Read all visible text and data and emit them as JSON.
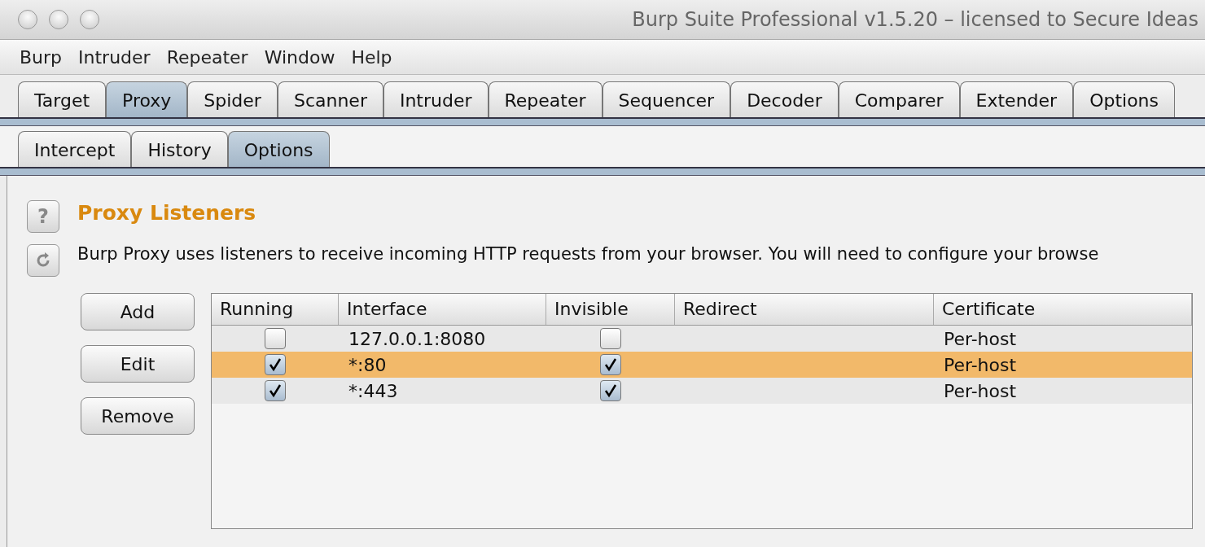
{
  "window": {
    "title": "Burp Suite Professional v1.5.20 – licensed to Secure Ideas"
  },
  "menu": [
    "Burp",
    "Intruder",
    "Repeater",
    "Window",
    "Help"
  ],
  "tabs": [
    {
      "label": "Target",
      "selected": false
    },
    {
      "label": "Proxy",
      "selected": true
    },
    {
      "label": "Spider",
      "selected": false
    },
    {
      "label": "Scanner",
      "selected": false
    },
    {
      "label": "Intruder",
      "selected": false
    },
    {
      "label": "Repeater",
      "selected": false
    },
    {
      "label": "Sequencer",
      "selected": false
    },
    {
      "label": "Decoder",
      "selected": false
    },
    {
      "label": "Comparer",
      "selected": false
    },
    {
      "label": "Extender",
      "selected": false
    },
    {
      "label": "Options",
      "selected": false
    }
  ],
  "subtabs": [
    {
      "label": "Intercept",
      "selected": false
    },
    {
      "label": "History",
      "selected": false
    },
    {
      "label": "Options",
      "selected": true
    }
  ],
  "section": {
    "title": "Proxy Listeners",
    "help_icon": "?",
    "description": "Burp Proxy uses listeners to receive incoming HTTP requests from your browser. You will need to configure your browse"
  },
  "buttons": [
    "Add",
    "Edit",
    "Remove"
  ],
  "table": {
    "columns": [
      "Running",
      "Interface",
      "Invisible",
      "Redirect",
      "Certificate"
    ],
    "rows": [
      {
        "running": false,
        "interface": "127.0.0.1:8080",
        "invisible": false,
        "certificate": "Per-host",
        "selected": false
      },
      {
        "running": true,
        "interface": "*:80",
        "invisible": true,
        "certificate": "Per-host",
        "selected": true
      },
      {
        "running": true,
        "interface": "*:443",
        "invisible": true,
        "certificate": "Per-host",
        "selected": false
      }
    ]
  }
}
